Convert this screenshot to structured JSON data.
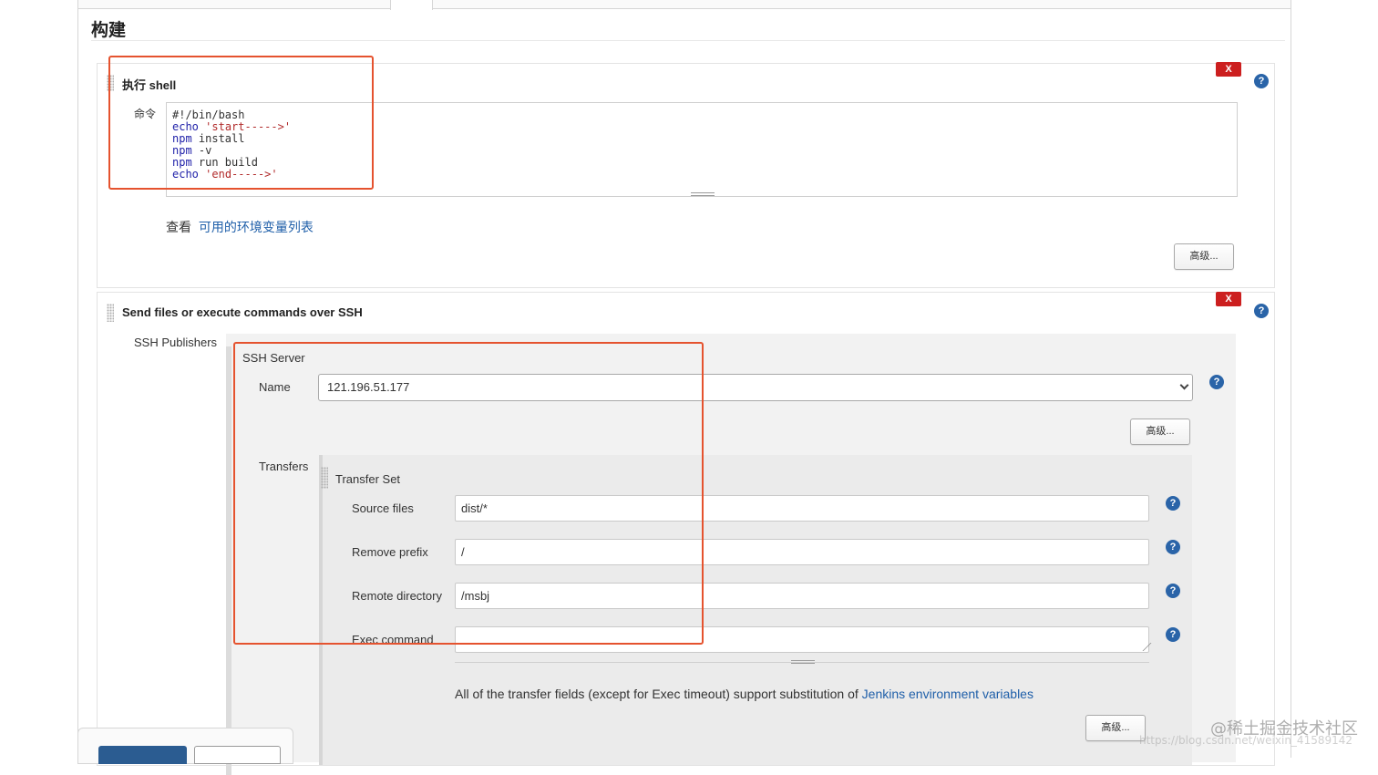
{
  "section": {
    "title": "构建"
  },
  "shell_step": {
    "title": "执行 shell",
    "command_label": "命令",
    "command_lines": [
      {
        "kw": "",
        "rest": "#!/bin/bash",
        "str": ""
      },
      {
        "kw": "echo",
        "rest": " ",
        "str": "'start----->'"
      },
      {
        "kw": "npm",
        "rest": " install",
        "str": ""
      },
      {
        "kw": "npm",
        "rest": " -v",
        "str": ""
      },
      {
        "kw": "npm",
        "rest": " run build",
        "str": ""
      },
      {
        "kw": "echo",
        "rest": " ",
        "str": "'end----->'"
      }
    ],
    "env_prefix": "查看",
    "env_link": "可用的环境变量列表",
    "advanced_label": "高级...",
    "delete_label": "X",
    "help_label": "?"
  },
  "ssh_step": {
    "title": "Send files or execute commands over SSH",
    "publishers_label": "SSH Publishers",
    "server_title": "SSH Server",
    "name_label": "Name",
    "name_value": "121.196.51.177",
    "server_advanced_label": "高级...",
    "transfers_label": "Transfers",
    "transfer_set_title": "Transfer Set",
    "fields": [
      {
        "label": "Source files",
        "value": "dist/*"
      },
      {
        "label": "Remove prefix",
        "value": "/"
      },
      {
        "label": "Remote directory",
        "value": "/msbj"
      }
    ],
    "exec_label": "Exec command",
    "exec_value": "",
    "substitution_note": "All of the transfer fields (except for Exec timeout) support substitution of",
    "substitution_link": "Jenkins environment variables",
    "transfer_advanced_label": "高级...",
    "delete_label": "X",
    "help_label": "?"
  },
  "watermark": {
    "brand": "@稀土掘金技术社区",
    "url": "https://blog.csdn.net/weixin_41589142"
  }
}
